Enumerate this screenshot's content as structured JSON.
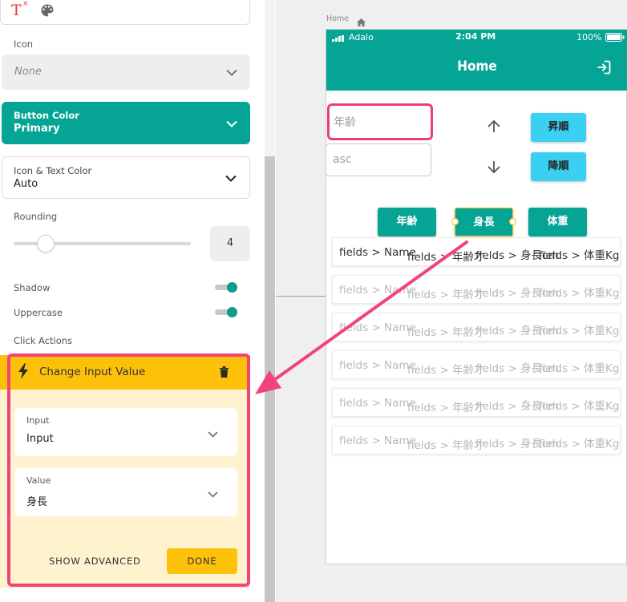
{
  "panel": {
    "icon_label": "Icon",
    "icon_value": "None",
    "button_color_label": "Button Color",
    "button_color_value": "Primary",
    "icon_text_color_label": "Icon & Text Color",
    "icon_text_color_value": "Auto",
    "rounding_label": "Rounding",
    "rounding_value": "4",
    "rounding_slider_fraction": 0.18,
    "shadow_label": "Shadow",
    "shadow_on": true,
    "uppercase_label": "Uppercase",
    "uppercase_on": true,
    "click_actions_label": "Click Actions"
  },
  "action": {
    "title": "Change Input Value",
    "input_label": "Input",
    "input_value": "Input",
    "value_label": "Value",
    "value_value": "身長",
    "show_advanced": "SHOW ADVANCED",
    "done": "DONE"
  },
  "canvas": {
    "breadcrumb": "Home",
    "status": {
      "carrier": "Adalo",
      "time": "2:04 PM",
      "battery": "100%"
    },
    "app_title": "Home",
    "age_placeholder": "年齢",
    "sort_value": "asc",
    "asc_button": "昇順",
    "desc_button": "降順",
    "tabs": [
      "年齢",
      "身長",
      "体重"
    ],
    "row_cells": [
      "fields > Name",
      "fields > 年齢才",
      "fields > 身長cm",
      "fields > 体重Kg"
    ],
    "row_count": 6
  },
  "colors": {
    "brand_teal": "#06a494",
    "accent_yellow": "#fdc10a",
    "annotation_pink": "#f0447a",
    "sort_button_blue": "#3ad0f1"
  }
}
